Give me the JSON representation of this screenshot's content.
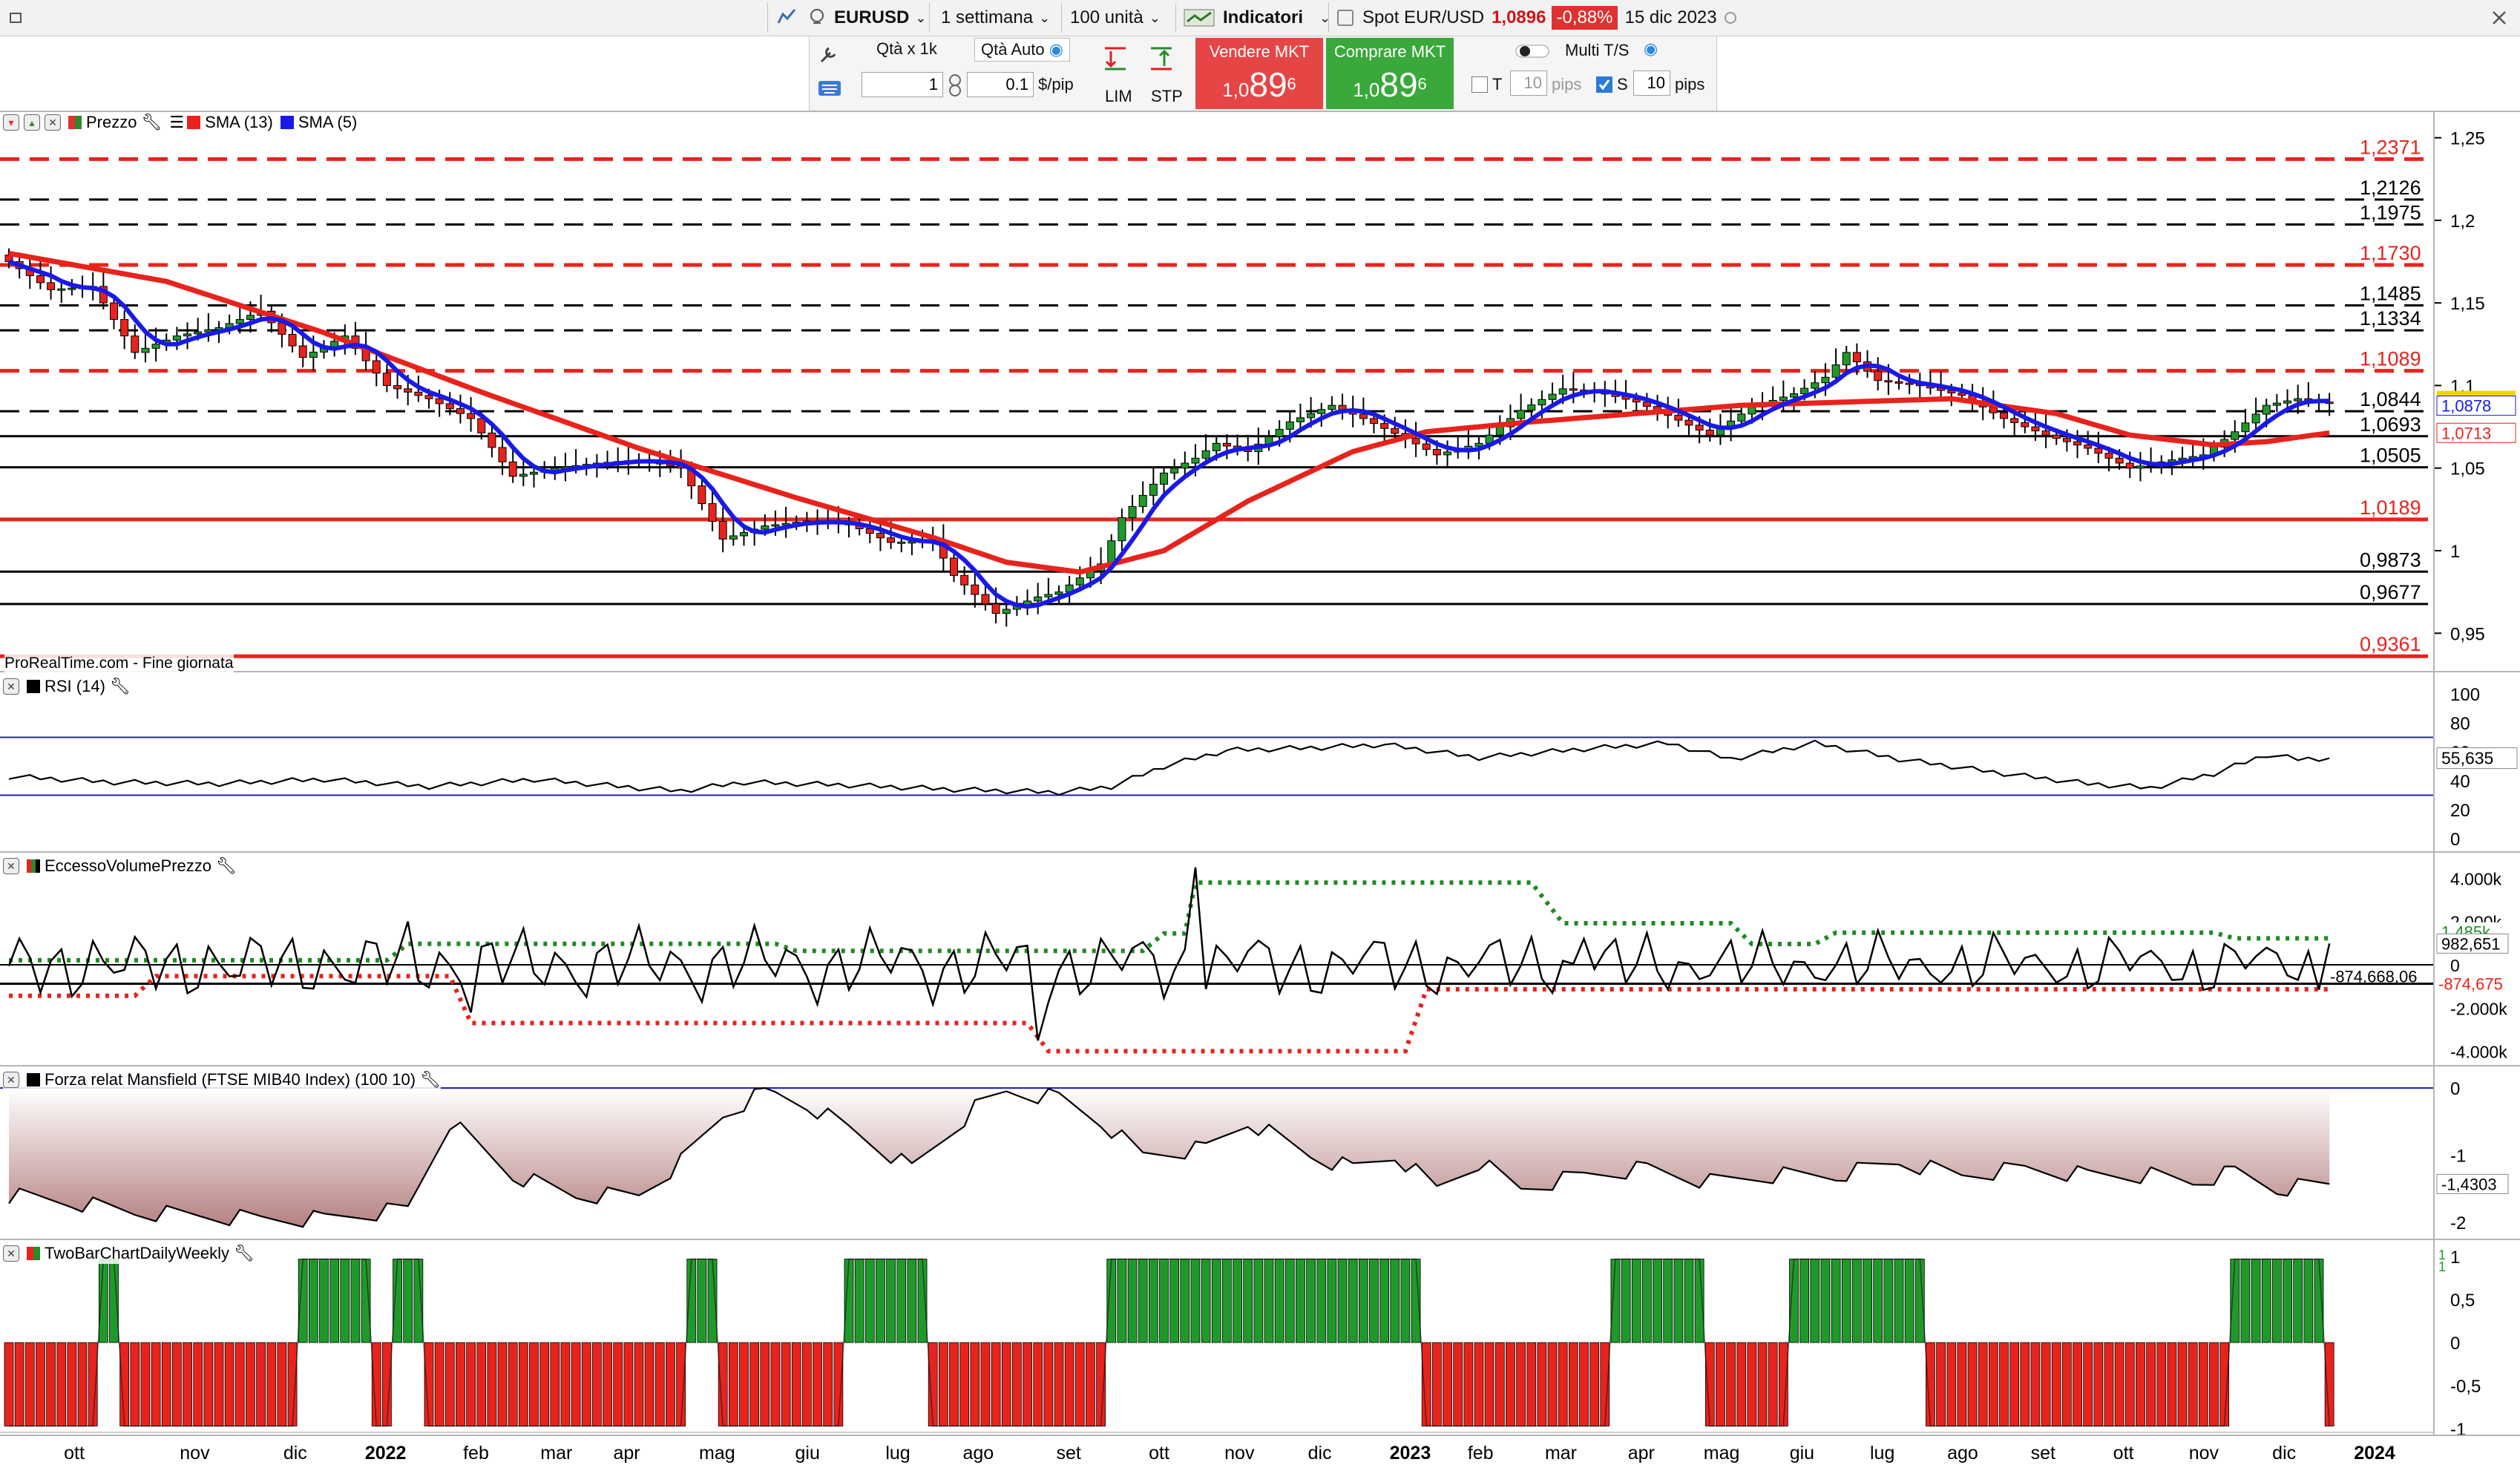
{
  "toolbar": {
    "symbol": "EURUSD",
    "period": "1 settimana",
    "units": "100 unità",
    "indicators": "Indicatori",
    "spot_label": "Spot EUR/USD",
    "spot_price": "1,0896",
    "spot_change": "-0,88%",
    "spot_date": "15 dic 2023"
  },
  "order": {
    "qty_label": "Qtà x 1k",
    "qty_auto": "Qtà Auto",
    "qty_value": "1",
    "pip_value": "0.1",
    "pip_unit": "$/pip",
    "lim": "LIM",
    "stp": "STP",
    "sell_label": "Vendere MKT",
    "sell_prefix": "1,0",
    "sell_big": "89",
    "sell_sup": "6",
    "buy_label": "Comprare MKT",
    "buy_prefix": "1,0",
    "buy_big": "89",
    "buy_sup": "6",
    "multi": "Multi T/S",
    "t_label": "T",
    "t_value": "10",
    "t_unit": "pips",
    "s_label": "S",
    "s_value": "10",
    "s_unit": "pips"
  },
  "price_panel": {
    "title_price": "Prezzo",
    "sma13_label": "SMA (13)",
    "sma5_label": "SMA (5)",
    "source": "ProRealTime.com - Fine giornata",
    "last_price": "1,0896",
    "sma5_value": "1,0878",
    "sma13_value": "1,0713",
    "axis_ticks": [
      "1,25",
      "1,2",
      "1,15",
      "1,1",
      "1,05",
      "1",
      "0,95"
    ]
  },
  "rsi_panel": {
    "title": "RSI (14)",
    "value": "55,635",
    "axis_ticks": [
      "100",
      "80",
      "60",
      "40",
      "20",
      "0"
    ]
  },
  "evp_panel": {
    "title": "EccessoVolumePrezzo",
    "upper_value": "1,485k",
    "value": "982,651",
    "lower_value": "-874,675",
    "line_label": "-874.668,06",
    "axis_ticks": [
      "4.000k",
      "2.000k",
      "0",
      "-2.000k",
      "-4.000k"
    ]
  },
  "mans_panel": {
    "title": "Forza relat Mansfield (FTSE MIB40 Index) (100 10)",
    "value": "-1,4303",
    "axis_ticks": [
      "0",
      "-1",
      "-2"
    ]
  },
  "twobar_panel": {
    "title": "TwoBarChartDailyWeekly",
    "axis_ticks": [
      "1",
      "0,5",
      "0",
      "-0,5",
      "-1"
    ],
    "marker_top": "1",
    "marker_bottom": "1"
  },
  "x_axis": [
    "ott",
    "nov",
    "dic",
    "2022",
    "feb",
    "mar",
    "apr",
    "mag",
    "giu",
    "lug",
    "ago",
    "set",
    "ott",
    "nov",
    "dic",
    "2023",
    "feb",
    "mar",
    "apr",
    "mag",
    "giu",
    "lug",
    "ago",
    "set",
    "ott",
    "nov",
    "dic",
    "2024"
  ],
  "colors": {
    "up": "#1f9a2a",
    "down": "#e8231c",
    "sma13": "#e8231c",
    "sma5": "#1a1ae6",
    "sell": "#e54545",
    "buy": "#3aa83a",
    "last_price_bg": "#f0d400"
  },
  "chart_data": {
    "type": "candlestick",
    "title": "EURUSD",
    "timeframe": "weekly",
    "levels": [
      {
        "value": 1.2371,
        "label": "1,2371",
        "color": "#e8231c",
        "style": "dashed"
      },
      {
        "value": 1.2126,
        "label": "1,2126",
        "color": "#000000",
        "style": "dashed"
      },
      {
        "value": 1.1975,
        "label": "1,1975",
        "color": "#000000",
        "style": "dashed"
      },
      {
        "value": 1.173,
        "label": "1,1730",
        "color": "#e8231c",
        "style": "dashed"
      },
      {
        "value": 1.1485,
        "label": "1,1485",
        "color": "#000000",
        "style": "dashed"
      },
      {
        "value": 1.1334,
        "label": "1,1334",
        "color": "#000000",
        "style": "dashed"
      },
      {
        "value": 1.1089,
        "label": "1,1089",
        "color": "#e8231c",
        "style": "dashed"
      },
      {
        "value": 1.0844,
        "label": "1,0844",
        "color": "#000000",
        "style": "dashed"
      },
      {
        "value": 1.0693,
        "label": "1,0693",
        "color": "#000000",
        "style": "solid"
      },
      {
        "value": 1.0505,
        "label": "1,0505",
        "color": "#000000",
        "style": "solid"
      },
      {
        "value": 1.0189,
        "label": "1,0189",
        "color": "#e8231c",
        "style": "solid"
      },
      {
        "value": 0.9873,
        "label": "0,9873",
        "color": "#000000",
        "style": "solid"
      },
      {
        "value": 0.9677,
        "label": "0,9677",
        "color": "#000000",
        "style": "solid"
      },
      {
        "value": 0.9361,
        "label": "0,9361",
        "color": "#e8231c",
        "style": "solid"
      }
    ],
    "price_ylim": [
      0.929,
      1.266
    ],
    "close_anchors": [
      [
        0,
        1.175
      ],
      [
        4,
        1.158
      ],
      [
        8,
        1.16
      ],
      [
        12,
        1.12
      ],
      [
        16,
        1.13
      ],
      [
        20,
        1.135
      ],
      [
        24,
        1.145
      ],
      [
        28,
        1.117
      ],
      [
        32,
        1.13
      ],
      [
        36,
        1.1
      ],
      [
        40,
        1.092
      ],
      [
        44,
        1.08
      ],
      [
        48,
        1.045
      ],
      [
        52,
        1.05
      ],
      [
        56,
        1.053
      ],
      [
        60,
        1.055
      ],
      [
        64,
        1.05
      ],
      [
        68,
        1.007
      ],
      [
        72,
        1.015
      ],
      [
        76,
        1.018
      ],
      [
        80,
        1.016
      ],
      [
        84,
        1.005
      ],
      [
        88,
        1.006
      ],
      [
        90,
        0.985
      ],
      [
        94,
        0.962
      ],
      [
        98,
        0.972
      ],
      [
        100,
        0.975
      ],
      [
        104,
        0.992
      ],
      [
        106,
        1.02
      ],
      [
        110,
        1.047
      ],
      [
        113,
        1.056
      ],
      [
        115,
        1.065
      ],
      [
        118,
        1.06
      ],
      [
        122,
        1.078
      ],
      [
        126,
        1.088
      ],
      [
        129,
        1.08
      ],
      [
        133,
        1.068
      ],
      [
        136,
        1.058
      ],
      [
        140,
        1.065
      ],
      [
        144,
        1.085
      ],
      [
        148,
        1.098
      ],
      [
        152,
        1.095
      ],
      [
        155,
        1.09
      ],
      [
        158,
        1.082
      ],
      [
        162,
        1.07
      ],
      [
        166,
        1.087
      ],
      [
        170,
        1.095
      ],
      [
        173,
        1.105
      ],
      [
        175,
        1.12
      ],
      [
        178,
        1.103
      ],
      [
        182,
        1.1
      ],
      [
        186,
        1.094
      ],
      [
        190,
        1.08
      ],
      [
        194,
        1.07
      ],
      [
        198,
        1.062
      ],
      [
        202,
        1.05
      ],
      [
        206,
        1.055
      ],
      [
        209,
        1.058
      ],
      [
        212,
        1.072
      ],
      [
        215,
        1.088
      ],
      [
        218,
        1.092
      ],
      [
        220,
        1.09
      ],
      [
        221,
        1.0896
      ]
    ],
    "sma13_anchors": [
      [
        0,
        1.18
      ],
      [
        15,
        1.163
      ],
      [
        30,
        1.132
      ],
      [
        45,
        1.096
      ],
      [
        60,
        1.062
      ],
      [
        75,
        1.032
      ],
      [
        88,
        1.008
      ],
      [
        95,
        0.993
      ],
      [
        102,
        0.987
      ],
      [
        110,
        1.0
      ],
      [
        118,
        1.03
      ],
      [
        128,
        1.06
      ],
      [
        135,
        1.072
      ],
      [
        145,
        1.078
      ],
      [
        155,
        1.083
      ],
      [
        165,
        1.088
      ],
      [
        175,
        1.09
      ],
      [
        185,
        1.092
      ],
      [
        195,
        1.083
      ],
      [
        202,
        1.07
      ],
      [
        210,
        1.064
      ],
      [
        215,
        1.066
      ],
      [
        221,
        1.0713
      ]
    ],
    "rsi_anchors": [
      [
        0,
        43
      ],
      [
        10,
        39
      ],
      [
        20,
        38
      ],
      [
        30,
        41
      ],
      [
        40,
        36
      ],
      [
        50,
        41
      ],
      [
        55,
        38
      ],
      [
        60,
        35
      ],
      [
        64,
        33
      ],
      [
        70,
        39
      ],
      [
        80,
        37
      ],
      [
        90,
        34
      ],
      [
        100,
        32
      ],
      [
        105,
        36
      ],
      [
        110,
        50
      ],
      [
        116,
        61
      ],
      [
        125,
        63
      ],
      [
        131,
        65
      ],
      [
        140,
        56
      ],
      [
        150,
        62
      ],
      [
        158,
        66
      ],
      [
        164,
        55
      ],
      [
        172,
        66
      ],
      [
        180,
        55
      ],
      [
        190,
        45
      ],
      [
        198,
        38
      ],
      [
        204,
        35
      ],
      [
        210,
        45
      ],
      [
        215,
        58
      ],
      [
        218,
        55
      ],
      [
        221,
        55.6
      ]
    ],
    "evp_upper_anchors": [
      [
        0,
        210
      ],
      [
        36,
        210
      ],
      [
        38,
        970
      ],
      [
        73,
        970
      ],
      [
        75,
        640
      ],
      [
        108,
        640
      ],
      [
        110,
        1450
      ],
      [
        112,
        1450
      ],
      [
        113,
        3800
      ],
      [
        145,
        3800
      ],
      [
        148,
        1920
      ],
      [
        164,
        1920
      ],
      [
        166,
        960
      ],
      [
        172,
        960
      ],
      [
        174,
        1485
      ],
      [
        210,
        1485
      ],
      [
        212,
        1220
      ],
      [
        221,
        1220
      ]
    ],
    "evp_lower_anchors": [
      [
        0,
        -1430
      ],
      [
        12,
        -1430
      ],
      [
        14,
        -520
      ],
      [
        42,
        -520
      ],
      [
        44,
        -2690
      ],
      [
        97,
        -2690
      ],
      [
        99,
        -3990
      ],
      [
        133,
        -3990
      ],
      [
        135,
        -1130
      ],
      [
        221,
        -1130
      ]
    ],
    "mansfield_anchors": [
      [
        0,
        -1.6
      ],
      [
        6,
        -1.7
      ],
      [
        12,
        -1.85
      ],
      [
        18,
        -1.9
      ],
      [
        24,
        -1.95
      ],
      [
        30,
        -1.95
      ],
      [
        38,
        -1.8
      ],
      [
        42,
        -0.5
      ],
      [
        48,
        -1.3
      ],
      [
        54,
        -1.6
      ],
      [
        60,
        -1.6
      ],
      [
        64,
        -1.1
      ],
      [
        68,
        -0.4
      ],
      [
        72,
        -0.05
      ],
      [
        76,
        -0.25
      ],
      [
        80,
        -0.6
      ],
      [
        86,
        -1.2
      ],
      [
        92,
        -0.3
      ],
      [
        95,
        -0.05
      ],
      [
        100,
        -0.15
      ],
      [
        104,
        -0.5
      ],
      [
        108,
        -1.0
      ],
      [
        114,
        -0.9
      ],
      [
        118,
        -0.5
      ],
      [
        124,
        -1.0
      ],
      [
        128,
        -1.2
      ],
      [
        132,
        -1.0
      ],
      [
        136,
        -1.5
      ],
      [
        140,
        -1.1
      ],
      [
        144,
        -1.5
      ],
      [
        150,
        -1.3
      ],
      [
        156,
        -1.2
      ],
      [
        162,
        -1.4
      ],
      [
        168,
        -1.3
      ],
      [
        174,
        -1.3
      ],
      [
        180,
        -1.1
      ],
      [
        186,
        -1.3
      ],
      [
        192,
        -1.2
      ],
      [
        198,
        -1.3
      ],
      [
        204,
        -1.3
      ],
      [
        208,
        -1.4
      ],
      [
        212,
        -1.25
      ],
      [
        216,
        -1.5
      ],
      [
        221,
        -1.43
      ]
    ],
    "twobar_runs": [
      [
        0,
        8,
        -1
      ],
      [
        9,
        10,
        1
      ],
      [
        11,
        27,
        -1
      ],
      [
        28,
        34,
        1
      ],
      [
        35,
        36,
        -1
      ],
      [
        37,
        39,
        1
      ],
      [
        40,
        64,
        -1
      ],
      [
        65,
        67,
        1
      ],
      [
        68,
        79,
        -1
      ],
      [
        80,
        87,
        1
      ],
      [
        88,
        104,
        -1
      ],
      [
        105,
        134,
        1
      ],
      [
        135,
        152,
        -1
      ],
      [
        153,
        161,
        1
      ],
      [
        162,
        169,
        -1
      ],
      [
        170,
        182,
        1
      ],
      [
        183,
        211,
        -1
      ],
      [
        212,
        220,
        1
      ],
      [
        221,
        221,
        -1
      ]
    ]
  }
}
